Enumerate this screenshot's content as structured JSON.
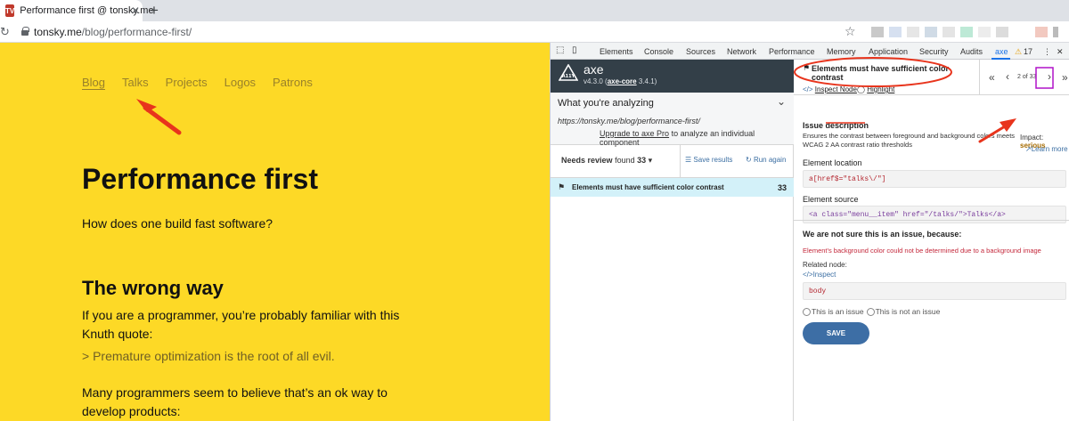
{
  "browser": {
    "tab_title": "Performance first @ tonsky.me",
    "favicon_text": "TV",
    "url_host": "tonsky.me",
    "url_path": "/blog/performance-first/"
  },
  "page": {
    "nav": [
      {
        "label": "Blog",
        "active": true
      },
      {
        "label": "Talks",
        "active": false
      },
      {
        "label": "Projects",
        "active": false
      },
      {
        "label": "Logos",
        "active": false
      },
      {
        "label": "Patrons",
        "active": false
      }
    ],
    "title": "Performance first",
    "lede": "How does one build fast software?",
    "h2": "The wrong way",
    "p1": "If you are a programmer, you’re probably familiar with this Knuth quote:",
    "quote": "> Premature optimization is the root of all evil.",
    "p2": "Many programmers seem to believe that’s an ok way to develop products:",
    "background_color": "#fdd926"
  },
  "devtools": {
    "tabs": [
      "Elements",
      "Console",
      "Sources",
      "Network",
      "Performance",
      "Memory",
      "Application",
      "Security",
      "Audits",
      "axe"
    ],
    "active_tab": "axe",
    "warning_count": "17"
  },
  "axe": {
    "name": "axe",
    "version": "v4.3.0",
    "core_label": "axe-core",
    "core_version": "3.4.1",
    "what_title": "What you're analyzing",
    "url": "https://tonsky.me/blog/performance-first/",
    "upgrade_link": "Upgrade to axe Pro",
    "upgrade_rest": "to analyze an individual component",
    "needs_review": "Needs review",
    "found_label": "found",
    "found_count": "33",
    "save_results": "Save results",
    "run_again": "Run again",
    "issue_title": "Elements must have sufficient color contrast",
    "issue_count": "33"
  },
  "detail": {
    "title": "Elements must have sufficient color contrast",
    "inspect_node": "Inspect Node",
    "highlight": "Highlight",
    "pager": "2 of 33",
    "issue_description_title": "Issue description",
    "issue_description": "Ensures the contrast between foreground and background colors meets WCAG 2 AA contrast ratio thresholds",
    "impact_label": "Impact:",
    "impact_value": "serious",
    "learn_more": "Learn more",
    "element_location_title": "Element location",
    "element_location": "a[href$=\"talks\\/\"]",
    "element_source_title": "Element source",
    "element_source": "<a class=\"menu__item\" href=\"/talks/\">Talks</a>",
    "not_sure_title": "We are not sure this is an issue, because:",
    "not_sure_reason": "Element's background color could not be determined due to a background image",
    "related_node_label": "Related node:",
    "related_inspect": "Inspect",
    "related_node": "body",
    "radio_issue": "This is an issue",
    "radio_not_issue": "This is not an issue",
    "save_button": "SAVE"
  },
  "colors": {
    "page_bg": "#fdd926",
    "axe_header": "#333f48",
    "link": "#3c6fa3",
    "save_button": "#3d6ea5",
    "annotation_red": "#e8341c",
    "annotation_purple": "#b012c8",
    "impact_serious": "#a66b00"
  }
}
